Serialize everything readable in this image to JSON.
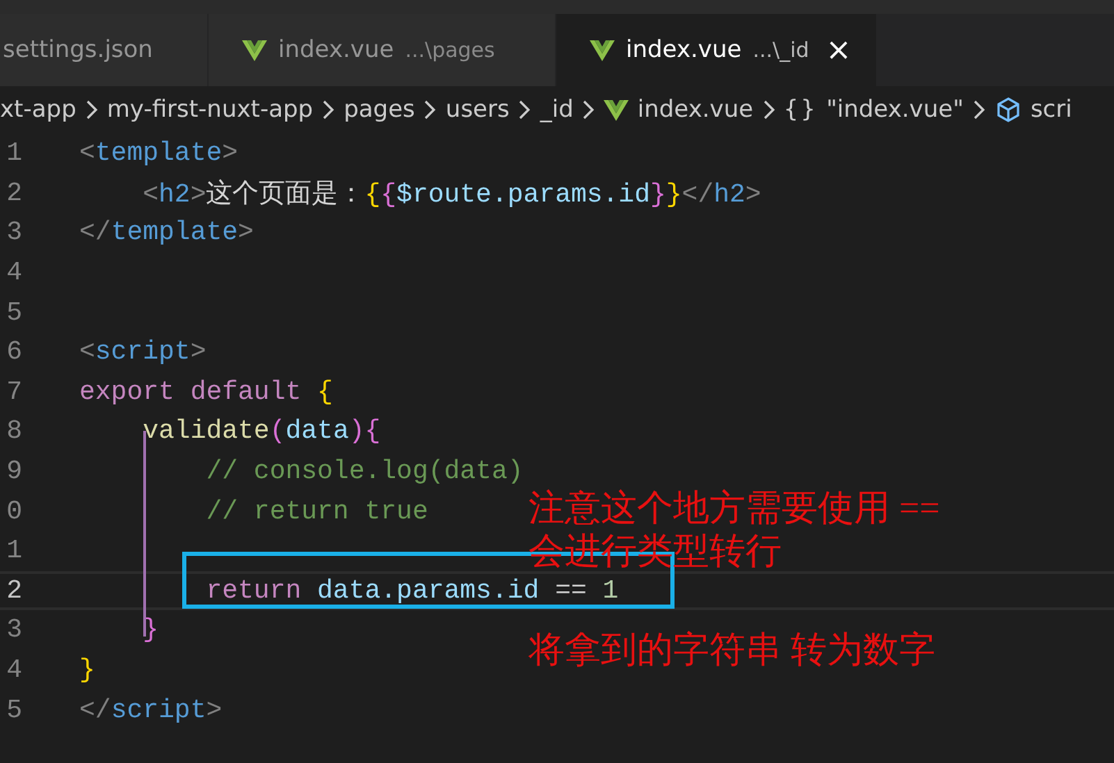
{
  "tabs": [
    {
      "label": "settings.json",
      "kind": "json",
      "selected": false
    },
    {
      "label": "index.vue",
      "description": "...\\pages",
      "kind": "vue",
      "selected": false
    },
    {
      "label": "index.vue",
      "description": "...\\_id",
      "kind": "vue",
      "selected": true,
      "close": "×"
    }
  ],
  "breadcrumb": [
    {
      "label": "xt-app",
      "kind": "folder"
    },
    {
      "label": "my-first-nuxt-app",
      "kind": "folder"
    },
    {
      "label": "pages",
      "kind": "folder"
    },
    {
      "label": "users",
      "kind": "folder"
    },
    {
      "label": "_id",
      "kind": "folder"
    },
    {
      "label": "index.vue",
      "kind": "vue"
    },
    {
      "label": "\"index.vue\"",
      "kind": "object",
      "symbol": "{}"
    },
    {
      "label": "scri",
      "kind": "module"
    }
  ],
  "code_lines": [
    {
      "number": "1",
      "current": false,
      "tokens": [
        {
          "text": "<",
          "kind": "punct"
        },
        {
          "text": "template",
          "kind": "tag"
        },
        {
          "text": ">",
          "kind": "punct"
        }
      ]
    },
    {
      "number": "2",
      "current": false,
      "tokens": [
        {
          "text": "    <",
          "kind": "punct"
        },
        {
          "text": "h2",
          "kind": "tag"
        },
        {
          "text": ">",
          "kind": "punct"
        },
        {
          "text": "这个页面是：",
          "kind": "plain"
        },
        {
          "text": "{",
          "kind": "brace"
        },
        {
          "text": "{",
          "kind": "brace2"
        },
        {
          "text": "$route.params.id",
          "kind": "var"
        },
        {
          "text": "}",
          "kind": "brace2"
        },
        {
          "text": "}",
          "kind": "brace"
        },
        {
          "text": "</",
          "kind": "punct"
        },
        {
          "text": "h2",
          "kind": "tag"
        },
        {
          "text": ">",
          "kind": "punct"
        }
      ]
    },
    {
      "number": "3",
      "current": false,
      "tokens": [
        {
          "text": "</",
          "kind": "punct"
        },
        {
          "text": "template",
          "kind": "tag"
        },
        {
          "text": ">",
          "kind": "punct"
        }
      ]
    },
    {
      "number": "4",
      "current": false
    },
    {
      "number": "5",
      "current": false
    },
    {
      "number": "6",
      "current": false,
      "tokens": [
        {
          "text": "<",
          "kind": "punct"
        },
        {
          "text": "script",
          "kind": "tag"
        },
        {
          "text": ">",
          "kind": "punct"
        }
      ]
    },
    {
      "number": "7",
      "current": false,
      "tokens": [
        {
          "text": "export default ",
          "kind": "keyword"
        },
        {
          "text": "{",
          "kind": "brace"
        }
      ]
    },
    {
      "number": "8",
      "current": false,
      "tokens": [
        {
          "text": "    validate",
          "kind": "func"
        },
        {
          "text": "(",
          "kind": "brace2"
        },
        {
          "text": "data",
          "kind": "var"
        },
        {
          "text": ")",
          "kind": "brace2"
        },
        {
          "text": "{",
          "kind": "brace2"
        }
      ]
    },
    {
      "number": "9",
      "current": false,
      "tokens": [
        {
          "text": "        // console.log(data)",
          "kind": "comment"
        }
      ]
    },
    {
      "number": "0",
      "current": false,
      "tokens": [
        {
          "text": "        // return true",
          "kind": "comment"
        }
      ]
    },
    {
      "number": "1",
      "current": false
    },
    {
      "number": "2",
      "current": true,
      "tokens": [
        {
          "text": "        return ",
          "kind": "keyword"
        },
        {
          "text": "data.params.id",
          "kind": "var"
        },
        {
          "text": " == ",
          "kind": "plain"
        },
        {
          "text": "1",
          "kind": "number"
        }
      ]
    },
    {
      "number": "3",
      "current": false,
      "tokens": [
        {
          "text": "    }",
          "kind": "brace2"
        }
      ]
    },
    {
      "number": "4",
      "current": false,
      "tokens": [
        {
          "text": "}",
          "kind": "brace"
        }
      ]
    },
    {
      "number": "5",
      "current": false,
      "tokens": [
        {
          "text": "</",
          "kind": "punct"
        },
        {
          "text": "script",
          "kind": "tag"
        },
        {
          "text": ">",
          "kind": "punct"
        }
      ]
    }
  ],
  "annotations": [
    "注意这个地方需要使用 ==",
    "会进行类型转行",
    "将拿到的字符串 转为数字"
  ]
}
